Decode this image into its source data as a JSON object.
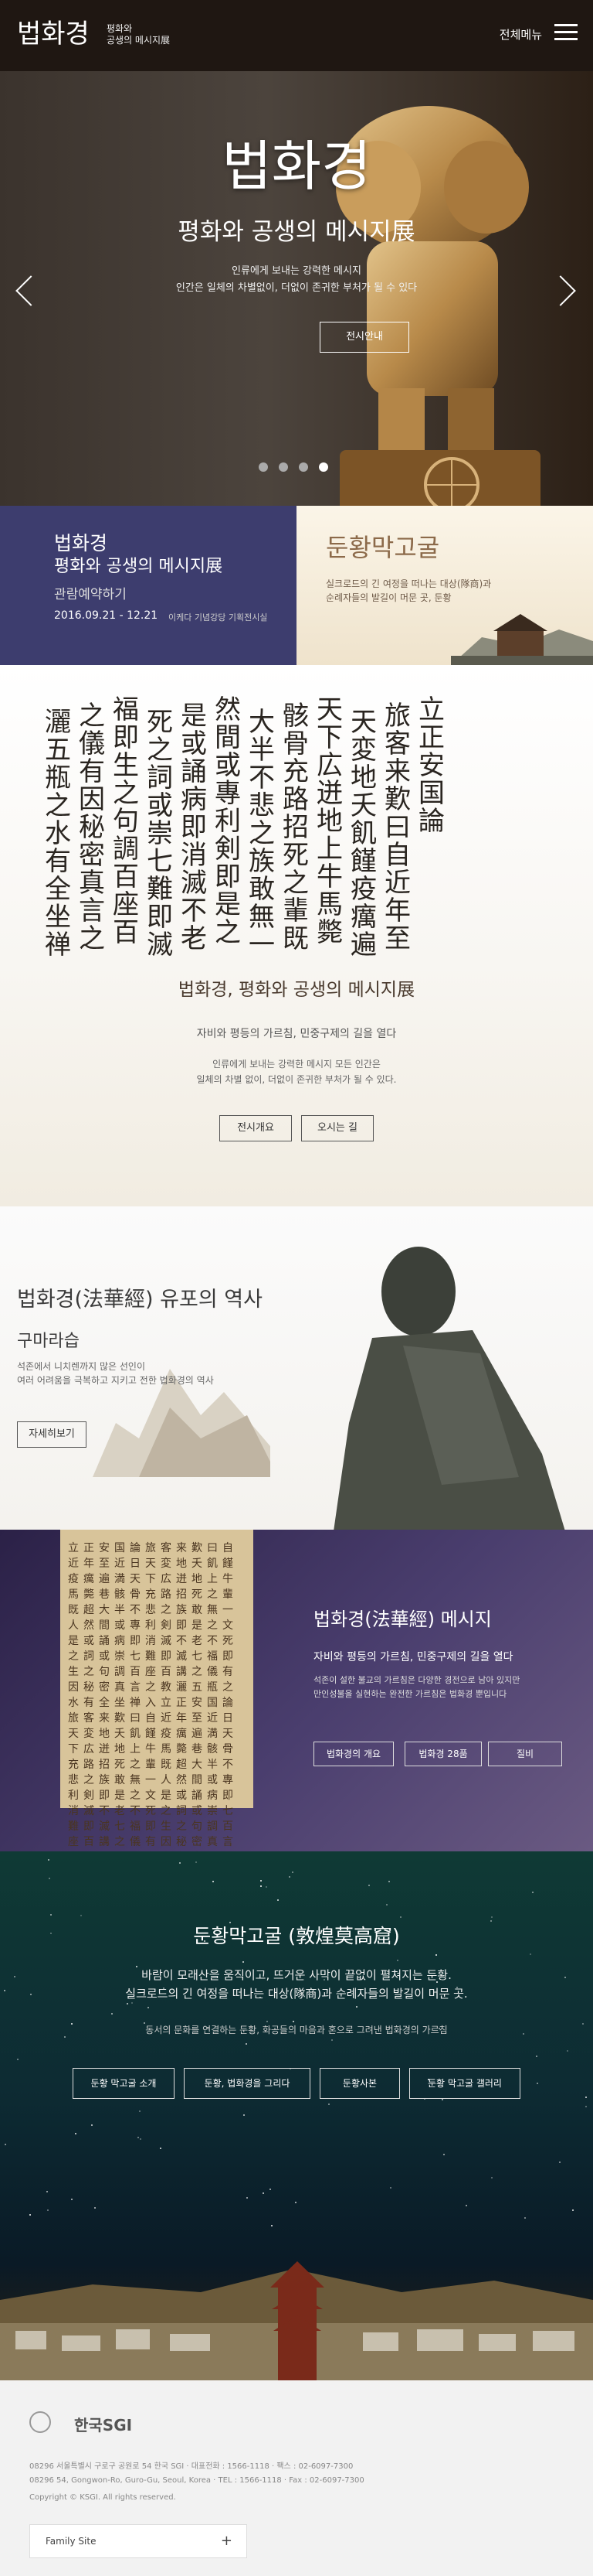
{
  "header": {
    "logo": "법화경",
    "logo_sub1": "평화와",
    "logo_sub2": "공생의 메시지展",
    "menu_label": "전체메뉴"
  },
  "hero": {
    "title": "법화경",
    "subtitle": "평화와 공생의 메시지展",
    "desc1": "인류에게 보내는 강력한 메시지",
    "desc2": "인간은 일체의 차별없이, 더없이 존귀한 부처가 될 수 있다",
    "button": "전시안내",
    "slides": 4,
    "active_slide": 4
  },
  "banner_left": {
    "title1": "법화경",
    "title2": "평화와 공생의 메시지展",
    "reserve": "관람예약하기",
    "dates": "2016.09.21 - 12.21",
    "venue": "이케다 기념강당 기획전시실"
  },
  "banner_right": {
    "title": "둔황막고굴",
    "desc1": "실크로드의 긴 여정을 떠나는 대상(隊商)과",
    "desc2": "순례자들의 발길이 머문 곳, 둔황"
  },
  "calligraphy": {
    "columns": [
      "立正安国論",
      "旅客来歎曰自近年至近日",
      "天変地夭飢饉疫癘遍満",
      "天下広迸地上牛馬斃巷",
      "骸骨充路招死之輩既超",
      "大半不悲之族敢無一人",
      "然間或專利剣即是之文",
      "是或誦病即消滅不老不",
      "死之詞或崇七難即滅七",
      "福即生之句調百座百講",
      "之儀有因秘密真言之教",
      "灑五瓶之水有全坐禅入"
    ],
    "title": "법화경, 평화와 공생의 메시지展",
    "subtitle": "자비와 평등의 가르침, 민중구제의 길을 열다",
    "desc1": "인류에게 보내는 강력한 메시지 모든 인간은",
    "desc2": "일체의 차별 없이, 더없이 존귀한 부처가 될 수 있다.",
    "btn1": "전시개요",
    "btn2": "오시는 길"
  },
  "history": {
    "title": "법화경(法華經) 유포의 역사",
    "subtitle": "구마라습",
    "desc1": "석존에서 니치렌까지 많은 선인이",
    "desc2": "여러 어려움을 극복하고 지키고 전한 법화경의 역사",
    "button": "자세히보기"
  },
  "message": {
    "title": "법화경(法華經) 메시지",
    "subtitle": "자비와 평등의 가르침, 민중구제의 길을 열다",
    "desc1": "석존이 설한 불교의 가르침은 다양한 경전으로 남아 있지만",
    "desc2": "만인성불을 실현하는 완전한 가르침은 법화경 뿐입니다",
    "buttons": [
      "법화경의 개요",
      "법화경 28품",
      "질비"
    ]
  },
  "dunhuang": {
    "title": "둔황막고굴 (敦煌莫高窟)",
    "desc1": "바람이 모래산을 움직이고, 뜨거운 사막이 끝없이 펼쳐지는 둔황.",
    "desc2": "실크로드의 긴 여정을 떠나는 대상(隊商)과 순례자들의 발길이 머문 곳.",
    "desc3": "동서의 문화를 연결하는 둔황, 화공들의 마음과 혼으로 그려낸 법화경의 가르침",
    "buttons": [
      "둔황 막고굴 소개",
      "둔황, 법화경을 그리다",
      "둔황사본",
      "둔황 막고굴 갤러리"
    ]
  },
  "footer": {
    "logo": "한국SGI",
    "addr1": "08296 서울특별시 구로구 공원로 54 한국 SGI · 대표전화 : 1566-1118 · 팩스 : 02-6097-7300",
    "addr2": "08296 54, Gongwon-Ro, Guro-Gu, Seoul, Korea · TEL : 1566-1118 · Fax : 02-6097-7300",
    "copyright": "Copyright © KSGI. All rights reserved.",
    "family": "Family Site",
    "family_icon": "+"
  }
}
